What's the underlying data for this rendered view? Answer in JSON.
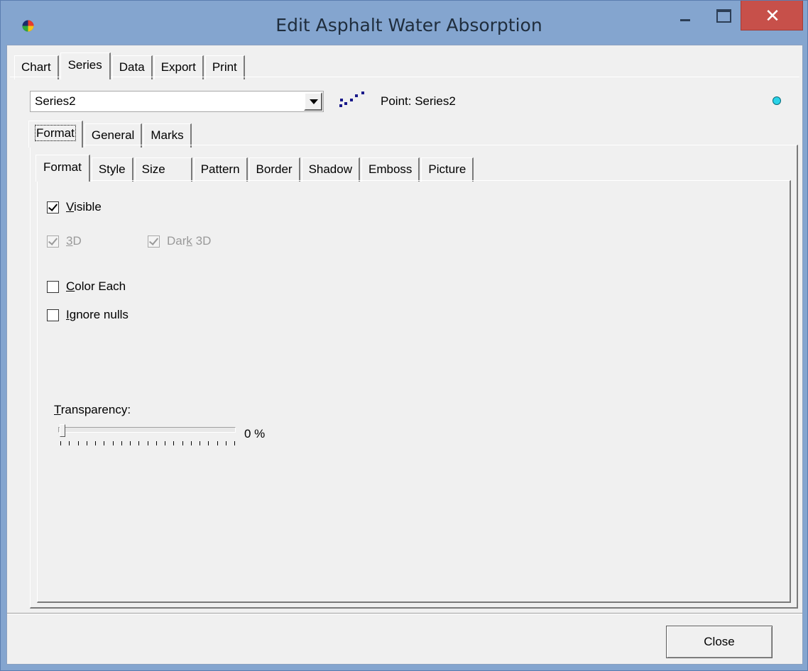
{
  "window": {
    "title": "Edit Asphalt Water Absorption",
    "close_glyph": "✕"
  },
  "main_tabs": [
    {
      "label": "Chart",
      "active": false
    },
    {
      "label": "Series",
      "active": true
    },
    {
      "label": "Data",
      "active": false
    },
    {
      "label": "Export",
      "active": false
    },
    {
      "label": "Print",
      "active": false
    }
  ],
  "series_selector": {
    "value": "Series2",
    "type_label": "Point: Series2",
    "icon": "point-series-icon",
    "color": "#2ad3e8"
  },
  "series_tabs": [
    {
      "label": "Format",
      "active": true
    },
    {
      "label": "General",
      "active": false
    },
    {
      "label": "Marks",
      "active": false
    }
  ],
  "format_tabs": [
    {
      "label": "Format",
      "active": true
    },
    {
      "label": "Style",
      "active": false
    },
    {
      "label": "Size",
      "active": false
    },
    {
      "label": "Pattern",
      "active": false
    },
    {
      "label": "Border",
      "active": false
    },
    {
      "label": "Shadow",
      "active": false
    },
    {
      "label": "Emboss",
      "active": false
    },
    {
      "label": "Picture",
      "active": false
    }
  ],
  "options": {
    "visible": {
      "label_pre": "",
      "label_u": "V",
      "label_post": "isible",
      "checked": true,
      "enabled": true
    },
    "three_d": {
      "label_pre": "",
      "label_u": "3",
      "label_post": "D",
      "checked": true,
      "enabled": false
    },
    "dark_3d": {
      "label_pre": "Dar",
      "label_u": "k",
      "label_post": " 3D",
      "checked": true,
      "enabled": false
    },
    "color_each": {
      "label_pre": "",
      "label_u": "C",
      "label_post": "olor Each",
      "checked": false,
      "enabled": true
    },
    "ignore_nulls": {
      "label_pre": "",
      "label_u": "I",
      "label_post": "gnore nulls",
      "checked": false,
      "enabled": true
    }
  },
  "transparency": {
    "label_u": "T",
    "label_post": "ransparency:",
    "value": 0,
    "value_text": "0 %"
  },
  "footer": {
    "close_label": "Close"
  }
}
